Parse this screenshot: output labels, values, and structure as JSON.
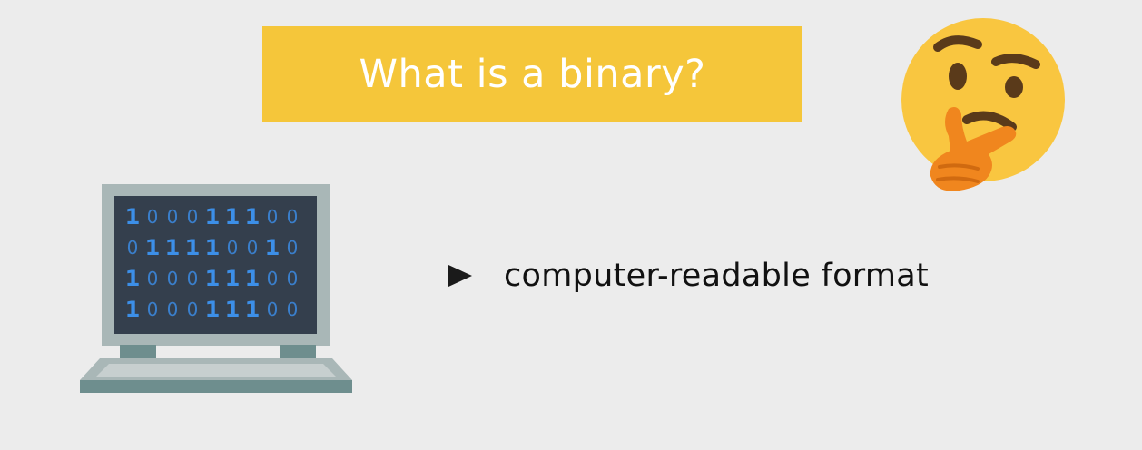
{
  "slide": {
    "title": "What is a binary?",
    "title_banner_color": "#f5c63a",
    "background_color": "#ececec"
  },
  "emoji": {
    "name": "thinking-face-icon"
  },
  "laptop": {
    "icon": "laptop-icon",
    "screen_rows": [
      [
        "1",
        "0",
        "0",
        "0",
        "1",
        "1",
        "1",
        "0",
        "0"
      ],
      [
        "0",
        "1",
        "1",
        "1",
        "1",
        "0",
        "0",
        "1",
        "0"
      ],
      [
        "1",
        "0",
        "0",
        "0",
        "1",
        "1",
        "1",
        "0",
        "0"
      ],
      [
        "1",
        "0",
        "0",
        "0",
        "1",
        "1",
        "1",
        "0",
        "0"
      ]
    ],
    "screen_color": "#343f4d",
    "digit_color": "#3a8ee6"
  },
  "bullets": [
    {
      "icon": "triangle-bullet-icon",
      "text": "computer-readable format"
    }
  ]
}
